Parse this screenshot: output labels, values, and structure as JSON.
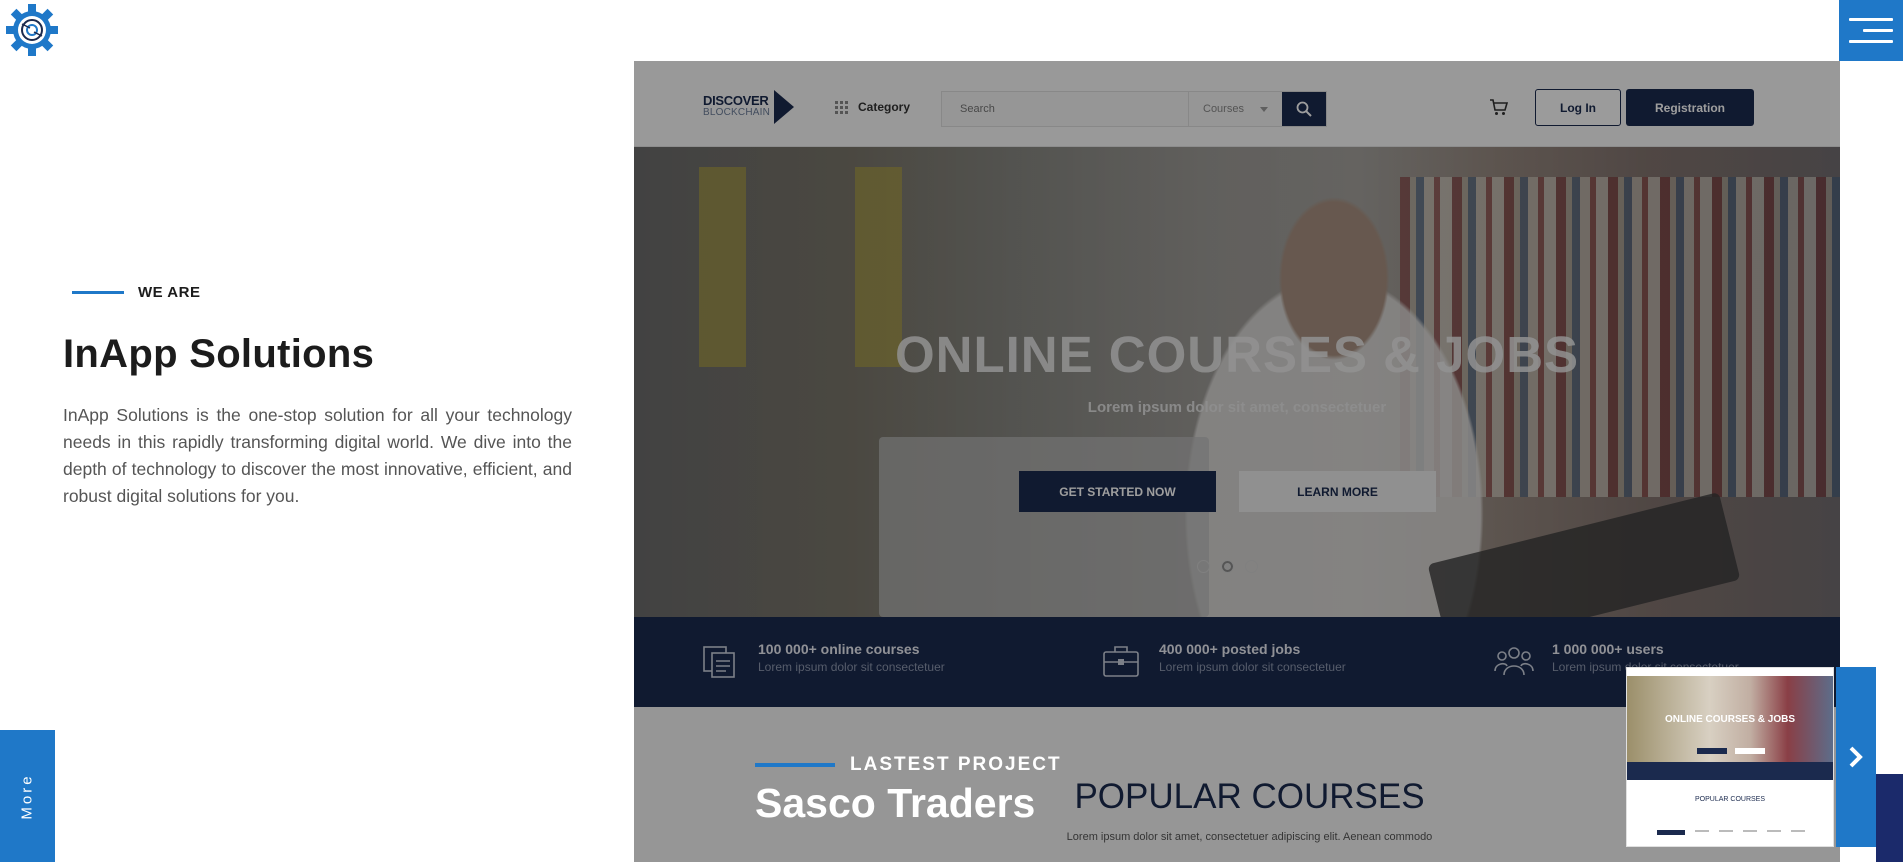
{
  "intro": {
    "eyebrow": "WE ARE",
    "title": "InApp Solutions",
    "description": "InApp Solutions is the one-stop solution for all your technology needs in this rapidly transforming digital world. We dive into the depth of technology to discover the most innovative, efficient, and robust digital solutions for you."
  },
  "more_tab": {
    "label": "More"
  },
  "preview": {
    "brand": {
      "line1": "DISCOVER",
      "line2": "BLOCKCHAIN"
    },
    "category_label": "Category",
    "search": {
      "placeholder": "Search",
      "select_value": "Courses"
    },
    "login_label": "Log In",
    "register_label": "Registration",
    "hero": {
      "title": "ONLINE COURSES & JOBS",
      "subtitle": "Lorem ipsum dolor sit amet, consectetuer",
      "primary_cta": "GET STARTED NOW",
      "secondary_cta": "LEARN MORE"
    },
    "stats": [
      {
        "title": "100 000+ online courses",
        "subtitle": "Lorem ipsum dolor sit consectetuer"
      },
      {
        "title": "400 000+  posted jobs",
        "subtitle": "Lorem ipsum dolor sit consectetuer"
      },
      {
        "title": "1 000 000+ users",
        "subtitle": "Lorem ipsum dolor sit consectetuer"
      }
    ],
    "popular": {
      "title": "POPULAR COURSES",
      "subtitle": "Lorem ipsum dolor sit amet, consectetuer adipiscing elit. Aenean commodo"
    }
  },
  "project": {
    "eyebrow": "LASTEST PROJECT",
    "name": "Sasco Traders"
  },
  "thumbnail": {
    "hero_title": "ONLINE COURSES & JOBS",
    "section_title": "POPULAR COURSES"
  },
  "colors": {
    "accent": "#1f78c8",
    "navy": "#1b2a4e"
  }
}
